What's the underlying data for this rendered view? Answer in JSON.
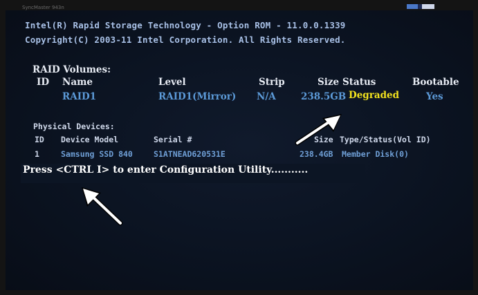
{
  "monitor": {
    "brand": "SyncMaster 943n"
  },
  "bios": {
    "title_line": "Intel(R) Rapid Storage Technology - Option ROM - 11.0.0.1339",
    "copyright_line": "Copyright(C) 2003-11 Intel Corporation.  All Rights Reserved."
  },
  "raid_volumes": {
    "heading": "RAID Volumes:",
    "columns": {
      "id": "ID",
      "name": "Name",
      "level": "Level",
      "strip": "Strip",
      "size": "Size",
      "status": "Status",
      "bootable": "Bootable"
    },
    "rows": [
      {
        "id": "",
        "name": "RAID1",
        "level": "RAID1(Mirror)",
        "strip": "N/A",
        "size": "238.5GB",
        "status": "Degraded",
        "bootable": "Yes"
      }
    ]
  },
  "physical_devices": {
    "heading": "Physical Devices:",
    "columns": {
      "id": "ID",
      "device_model": "Device Model",
      "serial": "Serial #",
      "size": "Size",
      "type_status": "Type/Status(Vol ID)"
    },
    "rows": [
      {
        "id": "1",
        "device_model": "Samsung SSD 840",
        "serial": "S1ATNEAD620531E",
        "size": "238.4GB",
        "type_status": "Member Disk(0)"
      }
    ]
  },
  "prompt": "Press <CTRL I> to enter Configuration Utility...........",
  "colors": {
    "screen_bg": "#0b1321",
    "header_text": "#a8c0e6",
    "value_blue": "#5c9ad8",
    "degraded_yellow": "#f2e21e",
    "member_green": "#3fbf7c",
    "arrow_white": "#ffffff"
  },
  "annotations": {
    "arrow_icon_count": 2
  }
}
